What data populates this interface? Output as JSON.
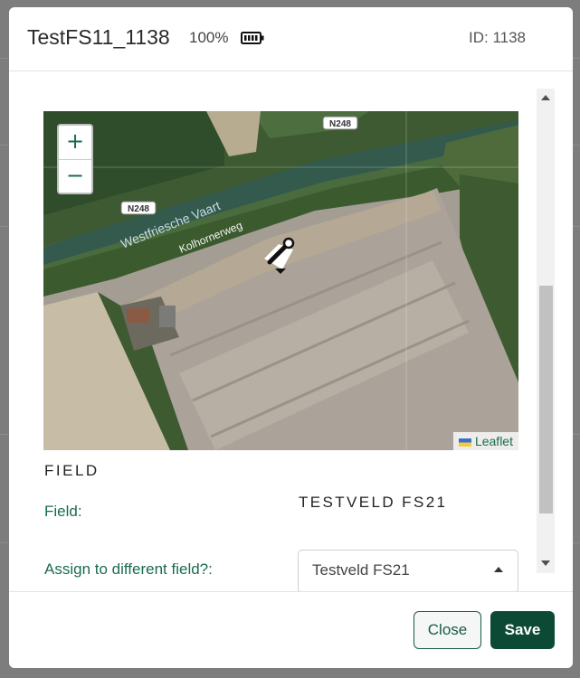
{
  "modal": {
    "title": "TestFS11_1138",
    "battery_level": "100%",
    "device_id": "ID: 1138"
  },
  "map": {
    "zoom_in": "+",
    "zoom_out": "−",
    "attribution": "Leaflet",
    "road_labels": [
      "N248",
      "N248",
      "Westfriesche Vaart",
      "Kolhornerweg"
    ]
  },
  "field_section": {
    "title": "FIELD",
    "field_label": "Field:",
    "field_value": "TESTVELD FS21",
    "assign_label": "Assign to different field?:",
    "assign_selected": "Testveld FS21"
  },
  "footer": {
    "close_label": "Close",
    "save_label": "Save"
  },
  "colors": {
    "accent": "#1a6b52",
    "primary_button": "#0d4a36"
  }
}
